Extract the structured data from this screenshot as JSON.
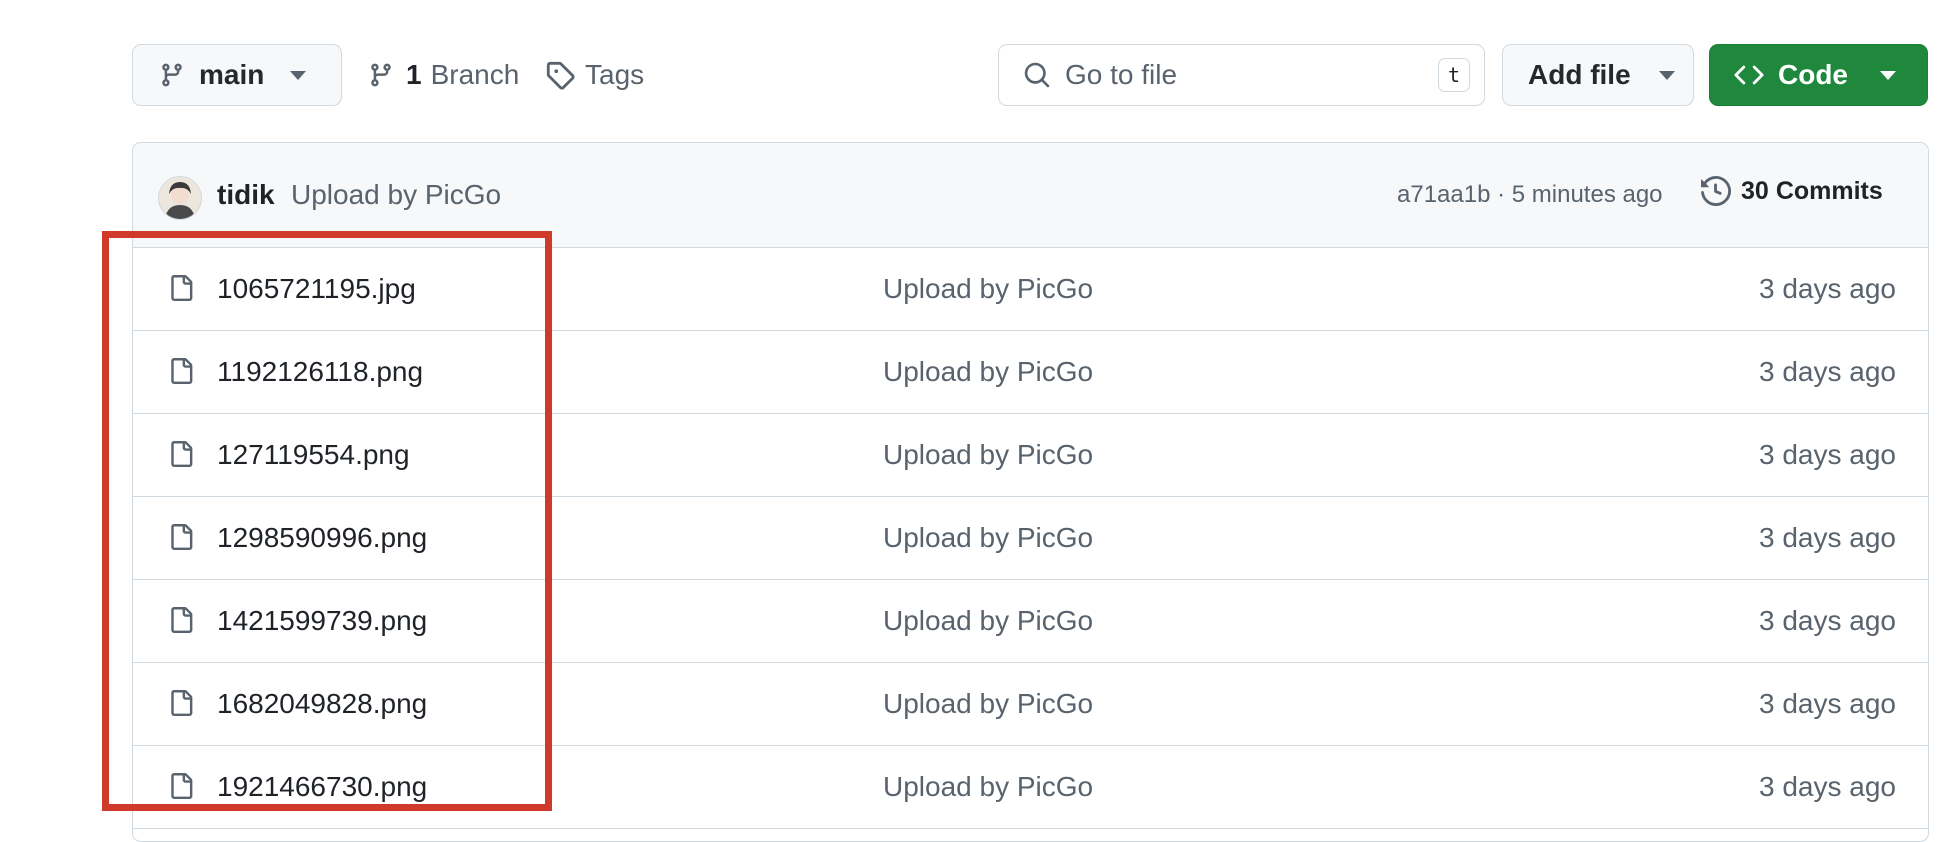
{
  "toolbar": {
    "branch_label": "main",
    "branches_count": "1",
    "branches_label": "Branch",
    "tags_label": "Tags",
    "search_placeholder": "Go to file",
    "search_shortcut": "t",
    "add_file_label": "Add file",
    "code_label": "Code"
  },
  "commit": {
    "author": "tidik",
    "message": "Upload by PicGo",
    "meta": "a71aa1b · 5 minutes ago",
    "commits_count": "30",
    "commits_label": "Commits"
  },
  "files": [
    {
      "name": "1065721195.jpg",
      "message": "Upload by PicGo",
      "date": "3 days ago"
    },
    {
      "name": "1192126118.png",
      "message": "Upload by PicGo",
      "date": "3 days ago"
    },
    {
      "name": "127119554.png",
      "message": "Upload by PicGo",
      "date": "3 days ago"
    },
    {
      "name": "1298590996.png",
      "message": "Upload by PicGo",
      "date": "3 days ago"
    },
    {
      "name": "1421599739.png",
      "message": "Upload by PicGo",
      "date": "3 days ago"
    },
    {
      "name": "1682049828.png",
      "message": "Upload by PicGo",
      "date": "3 days ago"
    },
    {
      "name": "1921466730.png",
      "message": "Upload by PicGo",
      "date": "3 days ago"
    }
  ],
  "colors": {
    "code_button": "#1f883d",
    "highlight_box": "#d03a2b"
  }
}
